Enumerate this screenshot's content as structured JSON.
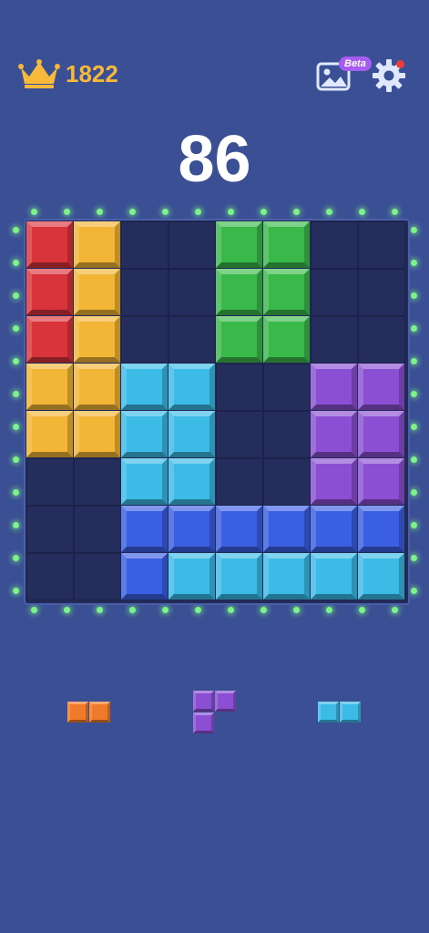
{
  "hud": {
    "best_score": "1822",
    "beta_label": "Beta",
    "score": "86",
    "crown_icon": "crown-icon",
    "gallery_icon": "image-gallery-icon",
    "settings_icon": "gear-icon"
  },
  "colors": {
    "background": "#3a4f94",
    "board": "#222a58",
    "red": "#d9343c",
    "yellow": "#f2b535",
    "green": "#3bb84a",
    "cyan": "#3bbbe6",
    "purple": "#8a4fd2",
    "blue": "#3b5fe3",
    "orange": "#ef7a2a",
    "lights": "#7df28a"
  },
  "board": {
    "columns": 8,
    "rows": 8,
    "grid": [
      [
        "red",
        "yellow",
        null,
        null,
        "green",
        "green",
        null,
        null
      ],
      [
        "red",
        "yellow",
        null,
        null,
        "green",
        "green",
        null,
        null
      ],
      [
        "red",
        "yellow",
        null,
        null,
        "green",
        "green",
        null,
        null
      ],
      [
        "yellow",
        "yellow",
        "cyan",
        "cyan",
        null,
        null,
        "purple",
        "purple"
      ],
      [
        "yellow",
        "yellow",
        "cyan",
        "cyan",
        null,
        null,
        "purple",
        "purple"
      ],
      [
        null,
        null,
        "cyan",
        "cyan",
        null,
        null,
        "purple",
        "purple"
      ],
      [
        null,
        null,
        "blue",
        "blue",
        "blue",
        "blue",
        "blue",
        "blue"
      ],
      [
        null,
        null,
        "blue",
        "cyan",
        "cyan",
        "cyan",
        "cyan",
        "cyan"
      ]
    ]
  },
  "tray": {
    "pieces": [
      {
        "name": "tray-piece-orange-domino",
        "color": "orange",
        "cells": [
          [
            0,
            0
          ],
          [
            1,
            0
          ]
        ]
      },
      {
        "name": "tray-piece-purple-corner",
        "color": "purple",
        "cells": [
          [
            0,
            0
          ],
          [
            1,
            0
          ],
          [
            0,
            1
          ]
        ]
      },
      {
        "name": "tray-piece-cyan-domino",
        "color": "cyan",
        "cells": [
          [
            0,
            0
          ],
          [
            1,
            0
          ]
        ]
      }
    ]
  }
}
